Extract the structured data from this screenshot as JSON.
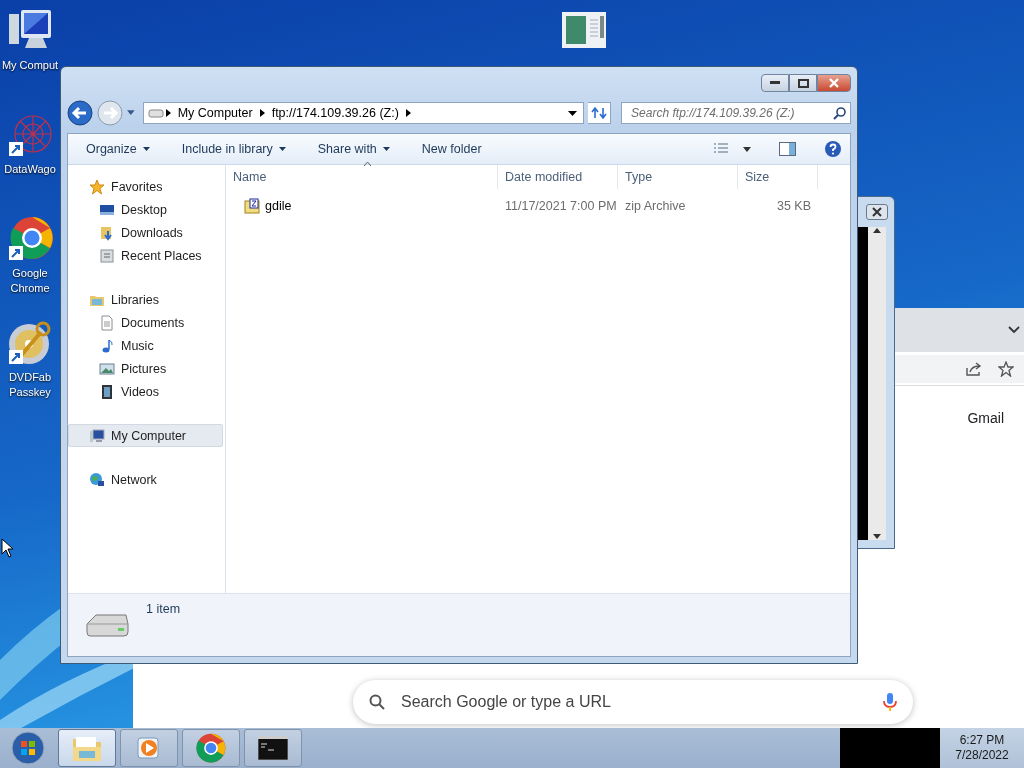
{
  "desktop_icons": [
    {
      "label": "My Comput",
      "kind": "computer"
    },
    {
      "label": "DataWago",
      "kind": "network-art"
    },
    {
      "label": "Google Chrome",
      "kind": "chrome"
    },
    {
      "label": "DVDFab Passkey",
      "kind": "disc"
    },
    {
      "kind": "window-thumb"
    }
  ],
  "chrome_window": {
    "search": {
      "placeholder": "Search Google or type a URL"
    },
    "links": [
      "Gmail"
    ]
  },
  "explorer": {
    "breadcrumb": [
      "My Computer",
      "ftp://174.109.39.26 (Z:)"
    ],
    "search": {
      "placeholder": "Search ftp://174.109.39.26 (Z:)"
    },
    "toolbar": [
      {
        "label": "Organize",
        "dropdown": true
      },
      {
        "label": "Include in library",
        "dropdown": true
      },
      {
        "label": "Share with",
        "dropdown": true
      },
      {
        "label": "New folder",
        "dropdown": false
      }
    ],
    "nav": [
      {
        "label": "Favorites",
        "selected": false,
        "children": [
          {
            "label": "Desktop",
            "selected": false
          },
          {
            "label": "Downloads",
            "selected": false
          },
          {
            "label": "Recent Places",
            "selected": false
          }
        ]
      },
      {
        "label": "Libraries",
        "selected": false,
        "children": [
          {
            "label": "Documents",
            "selected": false
          },
          {
            "label": "Music",
            "selected": false
          },
          {
            "label": "Pictures",
            "selected": false
          },
          {
            "label": "Videos",
            "selected": false
          }
        ]
      },
      {
        "label": "My Computer",
        "selected": true
      },
      {
        "label": "Network",
        "selected": false
      }
    ],
    "columns": [
      "Name",
      "Date modified",
      "Type",
      "Size"
    ],
    "rows": [
      {
        "name": "gdile",
        "date": "11/17/2021 7:00 PM",
        "type": "zip Archive",
        "size": "35 KB"
      }
    ],
    "status": "1 item"
  },
  "taskbar": {
    "buttons": [
      {
        "kind": "explorer",
        "selected": true
      },
      {
        "kind": "media",
        "selected": false
      },
      {
        "kind": "chrome",
        "selected": false
      },
      {
        "kind": "console",
        "selected": false
      }
    ],
    "clock": {
      "time": "6:27 PM",
      "date": "7/28/2022"
    }
  }
}
